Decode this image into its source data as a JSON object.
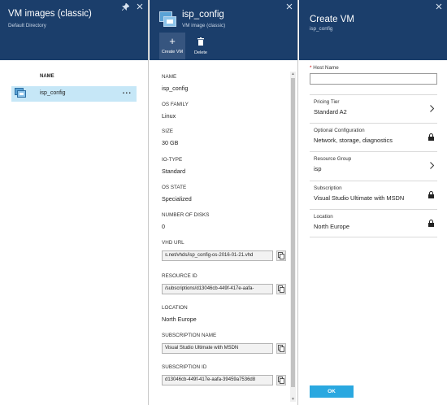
{
  "blade1": {
    "title": "VM images (classic)",
    "subtitle": "Default Directory",
    "column_header": "NAME",
    "rows": [
      {
        "name": "isp_config",
        "more": "..."
      }
    ]
  },
  "blade2": {
    "title": "isp_config",
    "subtitle": "VM image (classic)",
    "commands": {
      "create": "Create VM",
      "delete": "Delete"
    },
    "properties": {
      "name": {
        "label": "NAME",
        "value": "isp_config"
      },
      "os_family": {
        "label": "OS FAMILY",
        "value": "Linux"
      },
      "size": {
        "label": "SIZE",
        "value": "30 GB"
      },
      "io_type": {
        "label": "IO-TYPE",
        "value": "Standard"
      },
      "os_state": {
        "label": "OS STATE",
        "value": "Specialized"
      },
      "disks": {
        "label": "NUMBER OF DISKS",
        "value": "0"
      },
      "vhd_url": {
        "label": "VHD URL",
        "value": "s.net/vhds/isp_config-os-2016-01-21.vhd"
      },
      "resource_id": {
        "label": "RESOURCE ID",
        "value": "/subscriptions/d13046cb-449f-417e-aafa-"
      },
      "location": {
        "label": "LOCATION",
        "value": "North Europe"
      },
      "subscription_name": {
        "label": "SUBSCRIPTION NAME",
        "value": "Visual Studio Ultimate with MSDN"
      },
      "subscription_id": {
        "label": "SUBSCRIPTION ID",
        "value": "d13046cb-449f-417e-aafa-39459a7536d8"
      }
    }
  },
  "blade3": {
    "title": "Create VM",
    "subtitle": "isp_config",
    "host_name": {
      "required_mark": "*",
      "label": "Host Name",
      "value": ""
    },
    "options": [
      {
        "label": "Pricing Tier",
        "value": "Standard A2",
        "icon": "chevron-right-icon"
      },
      {
        "label": "Optional Configuration",
        "value": "Network, storage, diagnostics",
        "icon": "lock-icon"
      },
      {
        "label": "Resource Group",
        "value": "isp",
        "icon": "chevron-right-icon"
      },
      {
        "label": "Subscription",
        "value": "Visual Studio Ultimate with MSDN",
        "icon": "lock-icon"
      },
      {
        "label": "Location",
        "value": "North Europe",
        "icon": "lock-icon"
      }
    ],
    "ok_label": "OK"
  },
  "colors": {
    "header_bg": "#1b3e6b",
    "selected_row": "#c6e7f7",
    "ok_button": "#2aa8e0",
    "required": "#cc0000"
  }
}
